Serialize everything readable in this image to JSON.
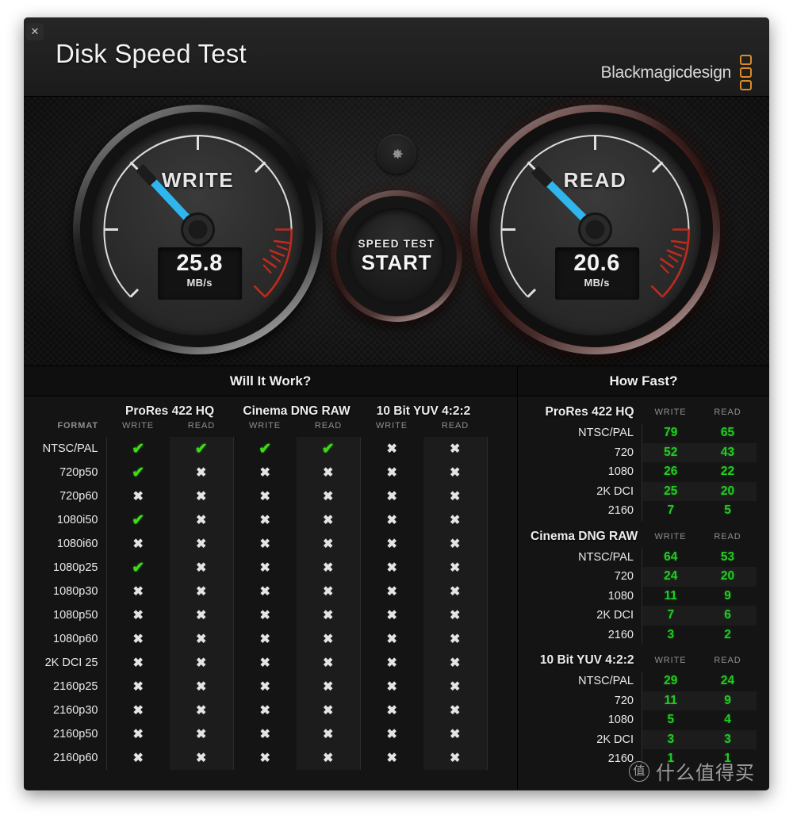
{
  "window": {
    "title": "Disk Speed Test",
    "close_label": "✕",
    "brand": "Blackmagicdesign"
  },
  "gauges": {
    "write": {
      "label": "WRITE",
      "value": "25.8",
      "unit": "MB/s",
      "needle_deg": -133
    },
    "read": {
      "label": "READ",
      "value": "20.6",
      "unit": "MB/s",
      "needle_deg": -135
    }
  },
  "start_button": {
    "sub_label": "SPEED TEST",
    "main_label": "START",
    "gear_icon": "gear-icon"
  },
  "will_it_work": {
    "title": "Will It Work?",
    "format_header": "FORMAT",
    "groups": [
      "ProRes 422 HQ",
      "Cinema DNG RAW",
      "10 Bit YUV 4:2:2"
    ],
    "sub_headers": [
      "WRITE",
      "READ",
      "WRITE",
      "READ",
      "WRITE",
      "READ"
    ],
    "pass_glyph": "✔",
    "fail_glyph": "✖",
    "rows": [
      {
        "format": "NTSC/PAL",
        "cells": [
          true,
          true,
          true,
          true,
          false,
          false
        ]
      },
      {
        "format": "720p50",
        "cells": [
          true,
          false,
          false,
          false,
          false,
          false
        ]
      },
      {
        "format": "720p60",
        "cells": [
          false,
          false,
          false,
          false,
          false,
          false
        ]
      },
      {
        "format": "1080i50",
        "cells": [
          true,
          false,
          false,
          false,
          false,
          false
        ]
      },
      {
        "format": "1080i60",
        "cells": [
          false,
          false,
          false,
          false,
          false,
          false
        ]
      },
      {
        "format": "1080p25",
        "cells": [
          true,
          false,
          false,
          false,
          false,
          false
        ]
      },
      {
        "format": "1080p30",
        "cells": [
          false,
          false,
          false,
          false,
          false,
          false
        ]
      },
      {
        "format": "1080p50",
        "cells": [
          false,
          false,
          false,
          false,
          false,
          false
        ]
      },
      {
        "format": "1080p60",
        "cells": [
          false,
          false,
          false,
          false,
          false,
          false
        ]
      },
      {
        "format": "2K DCI 25",
        "cells": [
          false,
          false,
          false,
          false,
          false,
          false
        ]
      },
      {
        "format": "2160p25",
        "cells": [
          false,
          false,
          false,
          false,
          false,
          false
        ]
      },
      {
        "format": "2160p30",
        "cells": [
          false,
          false,
          false,
          false,
          false,
          false
        ]
      },
      {
        "format": "2160p50",
        "cells": [
          false,
          false,
          false,
          false,
          false,
          false
        ]
      },
      {
        "format": "2160p60",
        "cells": [
          false,
          false,
          false,
          false,
          false,
          false
        ]
      }
    ]
  },
  "how_fast": {
    "title": "How Fast?",
    "col_write": "WRITE",
    "col_read": "READ",
    "blocks": [
      {
        "name": "ProRes 422 HQ",
        "rows": [
          {
            "label": "NTSC/PAL",
            "write": "79",
            "read": "65"
          },
          {
            "label": "720",
            "write": "52",
            "read": "43"
          },
          {
            "label": "1080",
            "write": "26",
            "read": "22"
          },
          {
            "label": "2K DCI",
            "write": "25",
            "read": "20"
          },
          {
            "label": "2160",
            "write": "7",
            "read": "5"
          }
        ]
      },
      {
        "name": "Cinema DNG RAW",
        "rows": [
          {
            "label": "NTSC/PAL",
            "write": "64",
            "read": "53"
          },
          {
            "label": "720",
            "write": "24",
            "read": "20"
          },
          {
            "label": "1080",
            "write": "11",
            "read": "9"
          },
          {
            "label": "2K DCI",
            "write": "7",
            "read": "6"
          },
          {
            "label": "2160",
            "write": "3",
            "read": "2"
          }
        ]
      },
      {
        "name": "10 Bit YUV 4:2:2",
        "rows": [
          {
            "label": "NTSC/PAL",
            "write": "29",
            "read": "24"
          },
          {
            "label": "720",
            "write": "11",
            "read": "9"
          },
          {
            "label": "1080",
            "write": "5",
            "read": "4"
          },
          {
            "label": "2K DCI",
            "write": "3",
            "read": "3"
          },
          {
            "label": "2160",
            "write": "1",
            "read": "1"
          }
        ]
      }
    ]
  },
  "watermark": {
    "mark": "值",
    "text": "什么值得买"
  },
  "colors": {
    "pass_green": "#3ddb16",
    "value_green": "#22cc22",
    "needle_blue": "#2eb6ef",
    "redzone": "#c02a1e",
    "brand_orange": "#d98b29"
  }
}
